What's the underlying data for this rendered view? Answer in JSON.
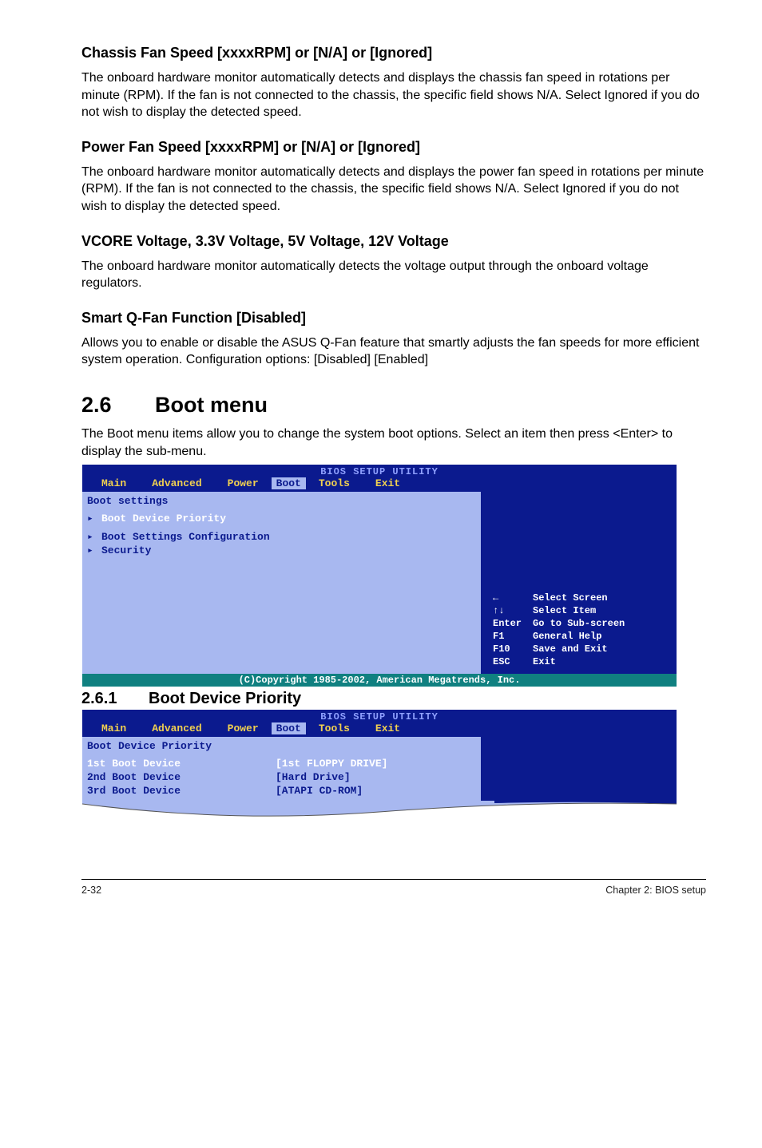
{
  "sections": {
    "chassis": {
      "heading": "Chassis Fan Speed [xxxxRPM] or [N/A] or [Ignored]",
      "body": "The onboard hardware monitor automatically detects and displays the chassis fan speed in rotations per minute (RPM). If the fan is not connected to the chassis, the specific field shows N/A. Select Ignored if you do not wish to display the detected speed."
    },
    "power": {
      "heading": "Power Fan Speed [xxxxRPM] or [N/A] or [Ignored]",
      "body": "The onboard hardware monitor automatically detects and displays the power fan speed in rotations per minute (RPM). If the fan is not connected to the chassis, the specific field shows N/A. Select Ignored if you do not wish to display the detected speed."
    },
    "vcore": {
      "heading": "VCORE Voltage, 3.3V Voltage, 5V Voltage, 12V Voltage",
      "body": "The onboard hardware monitor automatically detects the voltage output through the onboard voltage regulators."
    },
    "qfan": {
      "heading": "Smart Q-Fan Function [Disabled]",
      "body": "Allows you to enable or disable the ASUS Q-Fan feature that smartly adjusts the fan speeds for more efficient system operation. Configuration options: [Disabled] [Enabled]"
    }
  },
  "boot_menu": {
    "number": "2.6",
    "title": "Boot menu",
    "intro": "The Boot menu items allow you to change the system boot options. Select an item then press <Enter> to display the sub-menu."
  },
  "bios1": {
    "title": "BIOS SETUP UTILITY",
    "menus": [
      "Main",
      "Advanced",
      "Power",
      "Boot",
      "Tools",
      "Exit"
    ],
    "heading": "Boot settings",
    "items": [
      "Boot Device Priority",
      "Boot Settings Configuration",
      "Security"
    ],
    "help": [
      {
        "key": "←",
        "desc": "Select Screen"
      },
      {
        "key": "↑↓",
        "desc": "Select Item"
      },
      {
        "key": "Enter",
        "desc": "Go to Sub-screen"
      },
      {
        "key": "F1",
        "desc": "General Help"
      },
      {
        "key": "F10",
        "desc": "Save and Exit"
      },
      {
        "key": "ESC",
        "desc": "Exit"
      }
    ],
    "copyright": "(C)Copyright 1985-2002, American Megatrends, Inc."
  },
  "subsection": {
    "number": "2.6.1",
    "title": "Boot Device Priority"
  },
  "bios2": {
    "title": "BIOS SETUP UTILITY",
    "menus": [
      "Main",
      "Advanced",
      "Power",
      "Boot",
      "Tools",
      "Exit"
    ],
    "heading": "Boot Device Priority",
    "rows": [
      {
        "label": "1st Boot Device",
        "value": "[1st FLOPPY DRIVE]"
      },
      {
        "label": "2nd Boot Device",
        "value": "[Hard Drive]"
      },
      {
        "label": "3rd Boot Device",
        "value": "[ATAPI CD-ROM]"
      }
    ]
  },
  "footer": {
    "left": "2-32",
    "right": "Chapter 2: BIOS setup"
  }
}
